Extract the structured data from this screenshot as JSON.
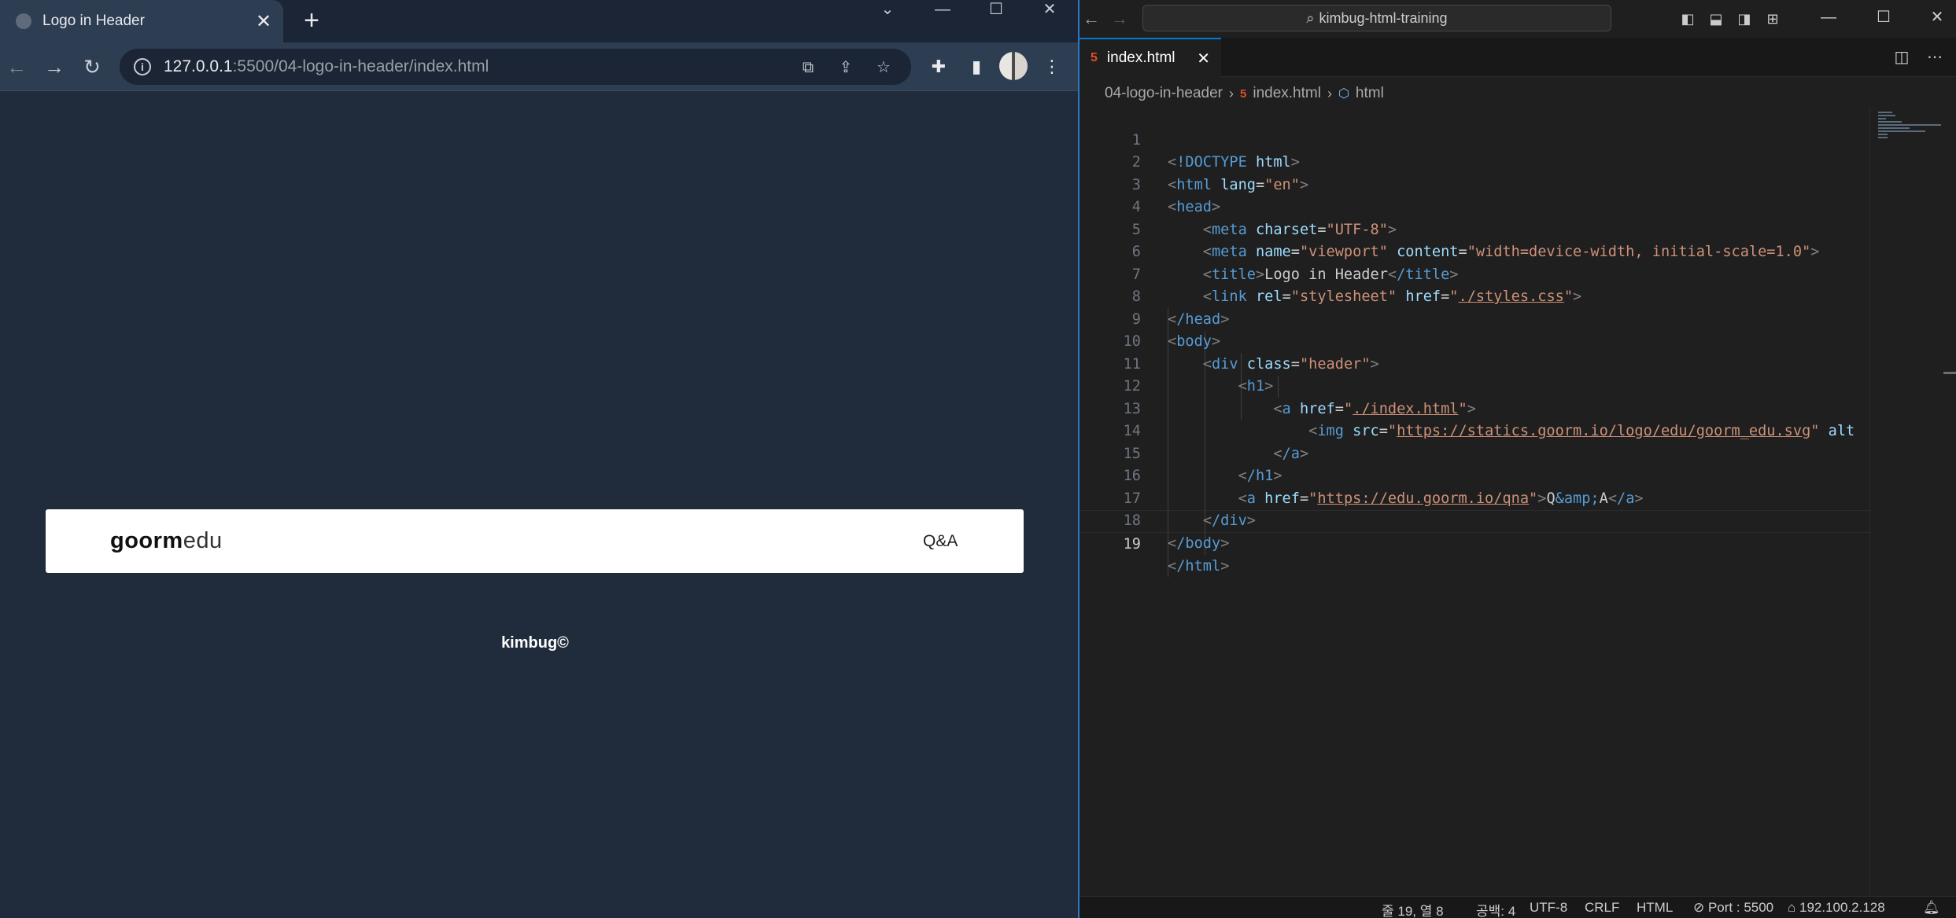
{
  "browser": {
    "tab_title": "Logo in Header",
    "url_host": "127.0.0.1",
    "url_rest": ":5500/04-logo-in-header/index.html",
    "page": {
      "logo_bold": "goorm",
      "logo_light": "edu",
      "qna_link": "Q&A",
      "footer_text": "kimbug©"
    }
  },
  "vscode": {
    "search_text": "kimbug-html-training",
    "tab_label": "index.html",
    "breadcrumb": [
      "04-logo-in-header",
      "index.html",
      "html"
    ],
    "active_line": 19,
    "lines": [
      {
        "n": "1"
      },
      {
        "n": "2"
      },
      {
        "n": "3"
      },
      {
        "n": "4"
      },
      {
        "n": "5"
      },
      {
        "n": "6"
      },
      {
        "n": "7"
      },
      {
        "n": "8"
      },
      {
        "n": "9"
      },
      {
        "n": "10"
      },
      {
        "n": "11"
      },
      {
        "n": "12"
      },
      {
        "n": "13"
      },
      {
        "n": "14"
      },
      {
        "n": "15"
      },
      {
        "n": "16"
      },
      {
        "n": "17"
      },
      {
        "n": "18"
      },
      {
        "n": "19"
      }
    ],
    "code": {
      "l1_doctype": "!DOCTYPE",
      "l1_html": "html",
      "l2_tag": "html",
      "l2_attr": "lang",
      "l2_val": "\"en\"",
      "l3_tag": "head",
      "l4_tag": "meta",
      "l4_attr": "charset",
      "l4_val": "\"UTF-8\"",
      "l5_tag": "meta",
      "l5_attr1": "name",
      "l5_val1": "\"viewport\"",
      "l5_attr2": "content",
      "l5_val2": "\"width=device-width, initial-scale=1.0\"",
      "l6_tag": "title",
      "l6_text": "Logo in Header",
      "l6_close": "/title",
      "l7_tag": "link",
      "l7_attr1": "rel",
      "l7_val1": "\"stylesheet\"",
      "l7_attr2": "href",
      "l7_val2_open": "\"",
      "l7_val2_link": "./styles.css",
      "l7_val2_close": "\"",
      "l8_tag": "/head",
      "l9_tag": "body",
      "l10_tag": "div",
      "l10_attr": "class",
      "l10_val": "\"header\"",
      "l11_tag": "h1",
      "l12_tag": "a",
      "l12_attr": "href",
      "l12_val_open": "\"",
      "l12_val_link": "./index.html",
      "l12_val_close": "\"",
      "l13_tag": "img",
      "l13_attr": "src",
      "l13_val_open": "\"",
      "l13_val_link": "https://statics.goorm.io/logo/edu/goorm_edu.svg",
      "l13_val_close": "\"",
      "l13_trunc": "alt",
      "l14_tag": "/a",
      "l15_tag": "/h1",
      "l16_tag": "a",
      "l16_attr": "href",
      "l16_val_open": "\"",
      "l16_val_link": "https://edu.goorm.io/qna",
      "l16_val_close": "\"",
      "l16_text_q": "Q",
      "l16_ent": "&amp;",
      "l16_text_a": "A",
      "l16_close": "/a",
      "l17_tag": "/div",
      "l18_tag": "/body",
      "l19_tag": "/html"
    },
    "status": {
      "position": "줄 19, 열 8",
      "spaces": "공백: 4",
      "encoding": "UTF-8",
      "eol": "CRLF",
      "language": "HTML",
      "port": "Port : 5500",
      "ip": "192.100.2.128"
    }
  }
}
